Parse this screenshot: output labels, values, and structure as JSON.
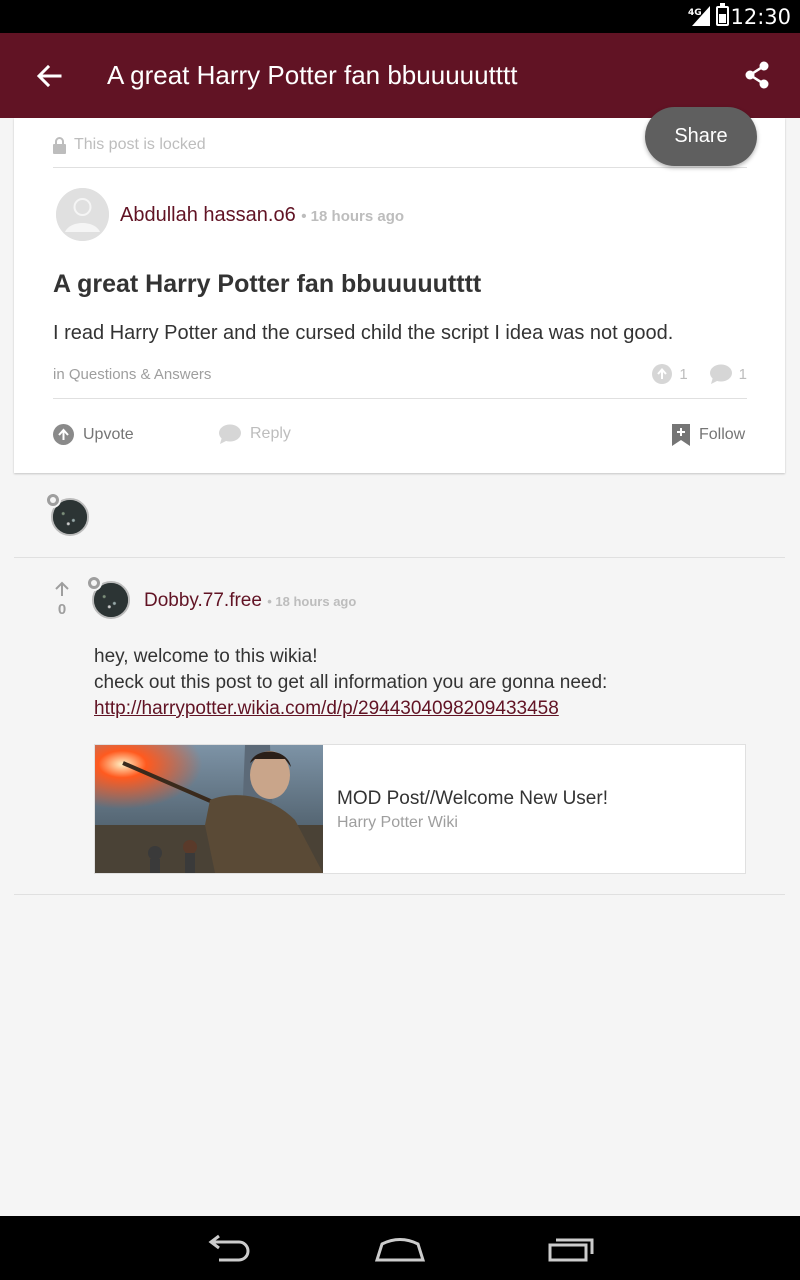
{
  "status_bar": {
    "network": "4G",
    "time": "12:30"
  },
  "app_bar": {
    "title": "A great Harry Potter fan bbuuuuutttt",
    "share_tooltip": "Share"
  },
  "post": {
    "locked_text": "This post is locked",
    "author": "Abdullah hassan.o6",
    "time": "• 18 hours ago",
    "title": "A great Harry Potter fan bbuuuuutttt",
    "body": "I read Harry Potter and the cursed child the script I idea was not good.",
    "category": "in Questions & Answers",
    "upvote_count": "1",
    "reply_count": "1",
    "actions": {
      "upvote": "Upvote",
      "reply": "Reply",
      "follow": "Follow"
    }
  },
  "reply": {
    "vote_count": "0",
    "author": "Dobby.77.free",
    "time": "• 18 hours ago",
    "line1": "hey, welcome to this wikia!",
    "line2": "check out this post to get all information you are gonna need:",
    "link": "http://harrypotter.wikia.com/d/p/2944304098209433458",
    "link_card": {
      "title": "MOD Post//Welcome New User!",
      "subtitle": "Harry Potter Wiki"
    }
  },
  "colors": {
    "brand": "#611324",
    "tooltip": "#5f5f5f"
  }
}
